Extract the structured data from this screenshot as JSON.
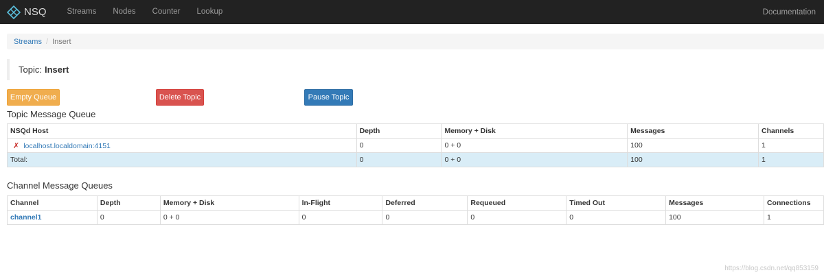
{
  "navbar": {
    "brand": "NSQ",
    "logo_icon": "nsq-logo-icon",
    "items": [
      "Streams",
      "Nodes",
      "Counter",
      "Lookup"
    ],
    "right_link": "Documentation"
  },
  "breadcrumb": {
    "link": "Streams",
    "separator": "/",
    "active": "Insert"
  },
  "topic": {
    "label": "Topic:",
    "name": "Insert"
  },
  "actions": {
    "empty_queue": "Empty Queue",
    "delete_topic": "Delete Topic",
    "pause_topic": "Pause Topic"
  },
  "topic_queue": {
    "title": "Topic Message Queue",
    "headers": [
      "NSQd Host",
      "Depth",
      "Memory + Disk",
      "Messages",
      "Channels"
    ],
    "rows": [
      {
        "host": "localhost.localdomain:4151",
        "status_icon": "x-mark-icon",
        "depth": "0",
        "memory_disk": "0 + 0",
        "messages": "100",
        "channels": "1"
      }
    ],
    "total": {
      "label": "Total:",
      "depth": "0",
      "memory_disk": "0 + 0",
      "messages": "100",
      "channels": "1"
    }
  },
  "channel_queues": {
    "title": "Channel Message Queues",
    "headers": [
      "Channel",
      "Depth",
      "Memory + Disk",
      "In-Flight",
      "Deferred",
      "Requeued",
      "Timed Out",
      "Messages",
      "Connections"
    ],
    "rows": [
      {
        "channel": "channel1",
        "depth": "0",
        "memory_disk": "0 + 0",
        "in_flight": "0",
        "deferred": "0",
        "requeued": "0",
        "timed_out": "0",
        "messages": "100",
        "connections": "1"
      }
    ]
  },
  "watermark": "https://blog.csdn.net/qq853159"
}
